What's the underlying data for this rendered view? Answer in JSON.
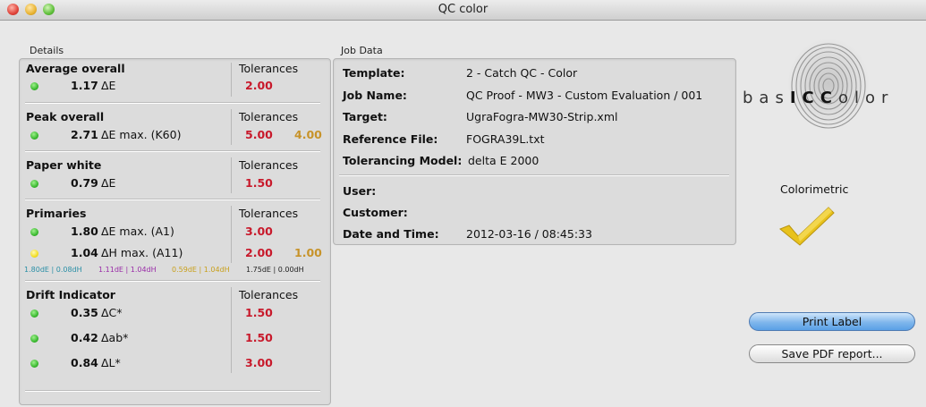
{
  "window": {
    "title": "QC color"
  },
  "details": {
    "group_label": "Details",
    "tolerances_label": "Tolerances",
    "average_overall": {
      "title": "Average overall",
      "value": "1.17",
      "unit": "ΔE",
      "tolerance": "2.00",
      "status": "green"
    },
    "peak_overall": {
      "title": "Peak overall",
      "value": "2.71",
      "unit": "ΔE max.  (K60)",
      "tolerance": "5.00",
      "tolerance2": "4.00",
      "status": "green"
    },
    "paper_white": {
      "title": "Paper white",
      "value": "0.79",
      "unit": "ΔE",
      "tolerance": "1.50",
      "status": "green"
    },
    "primaries": {
      "title": "Primaries",
      "row1": {
        "value": "1.80",
        "unit": "ΔE max.  (A1)",
        "tolerance": "3.00",
        "status": "green"
      },
      "row2": {
        "value": "1.04",
        "unit": "ΔH max.  (A11)",
        "tolerance": "2.00",
        "tolerance2": "1.00",
        "status": "yellow"
      },
      "breakdown": [
        {
          "text": "1.80dE | 0.08dH",
          "color": "#2a8fa6"
        },
        {
          "text": "1.11dE | 1.04dH",
          "color": "#9a2da8"
        },
        {
          "text": "0.59dE | 1.04dH",
          "color": "#c9a01c"
        },
        {
          "text": "1.75dE | 0.00dH",
          "color": "#222222"
        }
      ]
    },
    "drift": {
      "title": "Drift Indicator",
      "rows": [
        {
          "value": "0.35",
          "unit": "ΔC*",
          "tolerance": "1.50",
          "status": "green"
        },
        {
          "value": "0.42",
          "unit": "Δab*",
          "tolerance": "1.50",
          "status": "green"
        },
        {
          "value": "0.84",
          "unit": "ΔL*",
          "tolerance": "3.00",
          "status": "green"
        }
      ]
    }
  },
  "job": {
    "group_label": "Job Data",
    "template": {
      "label": "Template:",
      "value": "2 - Catch QC - Color"
    },
    "job_name": {
      "label": "Job Name:",
      "value": "QC Proof - MW3 - Custom Evaluation  /  001"
    },
    "target": {
      "label": "Target:",
      "value": "UgraFogra-MW30-Strip.xml"
    },
    "reference": {
      "label": "Reference File:",
      "value": "FOGRA39L.txt"
    },
    "tolerancing": {
      "label": "Tolerancing Model:",
      "value": "delta E 2000"
    },
    "user": {
      "label": "User:",
      "value": ""
    },
    "customer": {
      "label": "Customer:",
      "value": ""
    },
    "date_time": {
      "label": "Date and Time:",
      "value": "2012-03-16  /  08:45:33"
    }
  },
  "brand": {
    "logo_pre": "bas",
    "logo_mid": "ICC",
    "logo_post": "olor"
  },
  "result": {
    "label": "Colorimetric",
    "icon": "checkmark-icon",
    "color": "#e8c21c"
  },
  "buttons": {
    "print_label": "Print Label",
    "save_pdf": "Save PDF report..."
  },
  "colors": {
    "red": "#c8192b",
    "gold": "#c7932a",
    "accent": "#5aa0e6"
  }
}
